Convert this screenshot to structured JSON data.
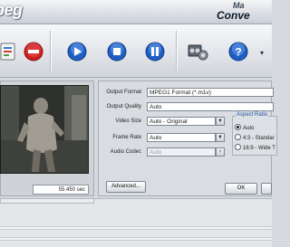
{
  "app": {
    "title_fragment": "peg",
    "logo_top": "Ma",
    "logo_bottom": "Conve"
  },
  "toolbar": {
    "buttons": [
      {
        "name": "add-files",
        "icon": "file-add-icon"
      },
      {
        "name": "remove",
        "icon": "no-entry-icon"
      },
      {
        "name": "play",
        "icon": "play-icon"
      },
      {
        "name": "stop",
        "icon": "stop-icon"
      },
      {
        "name": "pause",
        "icon": "pause-icon"
      },
      {
        "name": "convert",
        "icon": "film-gear-icon"
      },
      {
        "name": "help",
        "icon": "help-icon"
      }
    ]
  },
  "preview": {
    "time": "55.450 sec"
  },
  "options": {
    "output_format": {
      "label": "Output Format",
      "value": "MPEG1 Format (*.m1v)"
    },
    "output_quality": {
      "label": "Output Quality",
      "value": "Auto"
    },
    "video_size": {
      "label": "Video Size",
      "value": "Auto - Original"
    },
    "frame_rate": {
      "label": "Frame Rate",
      "value": "Auto"
    },
    "audio_codec": {
      "label": "Audio Codec",
      "value": "Auto"
    },
    "advanced_button": "Advanced...",
    "ok_button": "OK"
  },
  "aspect_ratio": {
    "title": "Aspect Ratio",
    "options": [
      "Auto",
      "4:3 - Standar",
      "16:9 - Wide T"
    ],
    "selected": "Auto"
  },
  "colors": {
    "accent_blue": "#1f5fc4",
    "stop_red": "#cc1f1f",
    "group_title": "#1f4fa0"
  }
}
